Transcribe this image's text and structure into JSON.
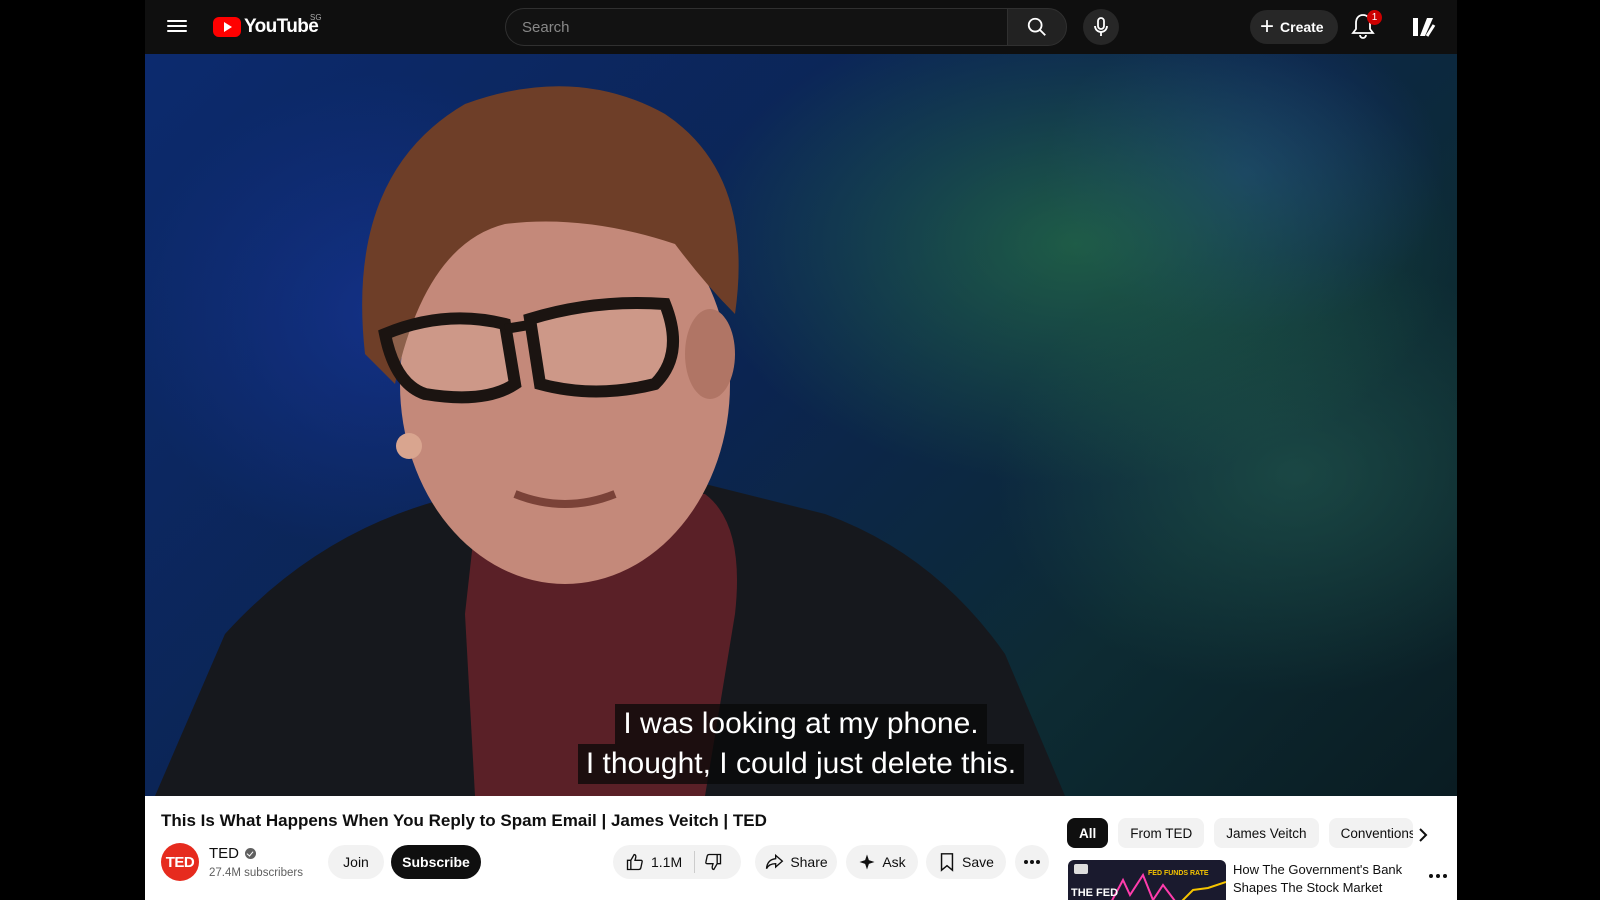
{
  "header": {
    "logo_text": "YouTube",
    "region": "SG",
    "search_placeholder": "Search",
    "create_label": "Create",
    "notification_count": "1"
  },
  "video": {
    "caption_line1": "I was looking at my phone.",
    "caption_line2": "I thought, I could just delete this."
  },
  "details": {
    "title": "This Is What Happens When You Reply to Spam Email | James Veitch | TED",
    "channel_initials": "TED",
    "channel_name": "TED",
    "subscribers": "27.4M subscribers",
    "join_label": "Join",
    "subscribe_label": "Subscribe",
    "like_count": "1.1M",
    "share_label": "Share",
    "ask_label": "Ask",
    "save_label": "Save"
  },
  "sidebar": {
    "chips": [
      "All",
      "From TED",
      "James Veitch",
      "Conventions"
    ],
    "recommendation": {
      "title": "How The Government's Bank Shapes The Stock Market",
      "thumb_text": "THE FED",
      "thumb_label": "FED FUNDS RATE"
    }
  },
  "colors": {
    "brand_red": "#ff0000",
    "ted_red": "#e62b1e",
    "header_bg": "#0f0f0f"
  }
}
